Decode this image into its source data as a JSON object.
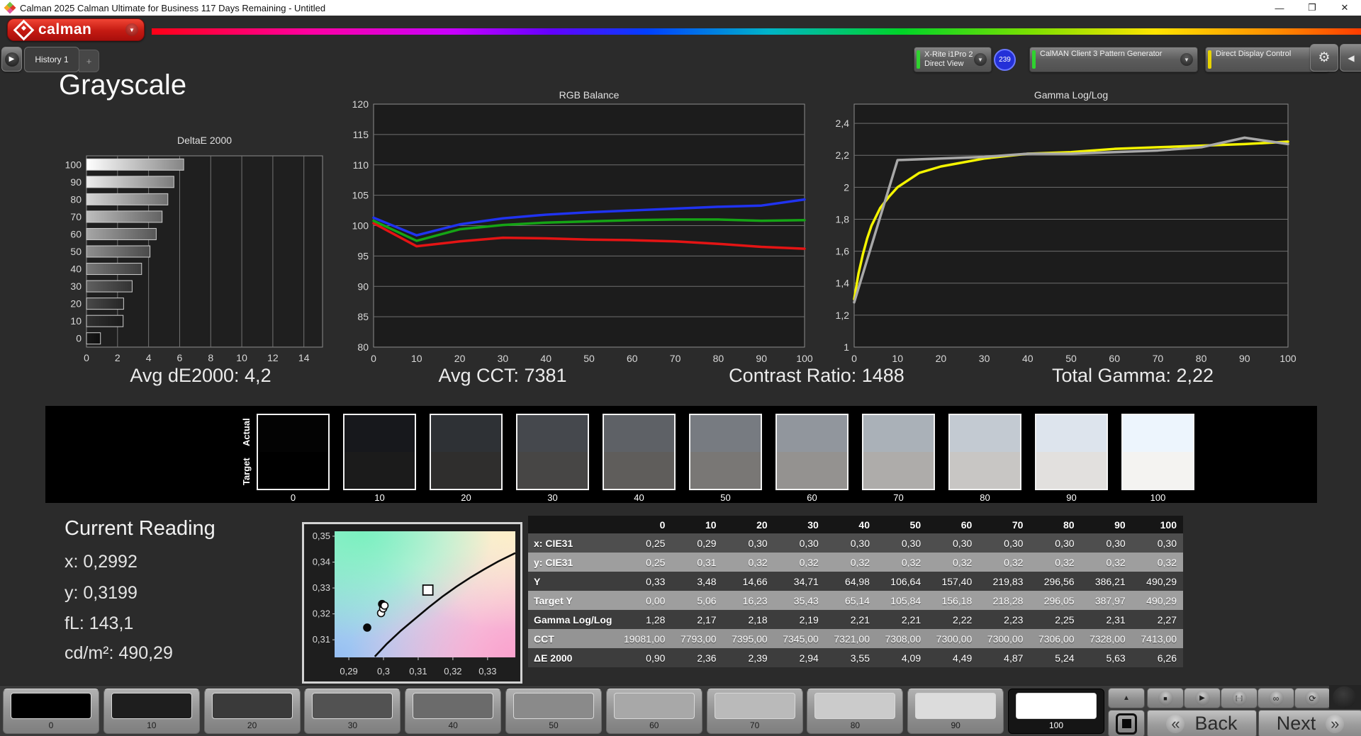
{
  "window": {
    "title": "Calman 2025 Calman Ultimate for Business 117 Days Remaining  - Untitled"
  },
  "icons": {
    "dropdown_arrow": "▼",
    "play_tab": "▶",
    "plus": "+",
    "gear": "⚙",
    "collapse_left": "◀",
    "minimize": "—",
    "restore": "❐",
    "close": "✕",
    "up_arrow": "▲",
    "stop": "■",
    "play": "▶",
    "pattern_window": "[··]",
    "continuous": "∞",
    "refresh": "⟳",
    "back_chevron": "«",
    "next_chevron": "»"
  },
  "header": {
    "logo_text": "calman",
    "history_tab": "History 1",
    "add_tab": "+",
    "meter_dropdown": {
      "line1": "X-Rite i1Pro 2",
      "line2": "Direct View",
      "stripe_color": "#2fd32f"
    },
    "meter_badge": "239",
    "pattern_dropdown": {
      "label": "CalMAN Client 3 Pattern Generator",
      "stripe_color": "#2fd32f"
    },
    "display_dropdown": {
      "label": "Direct Display Control",
      "stripe_color": "#e8d400"
    }
  },
  "page": {
    "title": "Grayscale"
  },
  "stats": {
    "avg_de": "Avg dE2000: 4,2",
    "avg_cct": "Avg CCT: 7381",
    "contrast": "Contrast Ratio: 1488",
    "total_gamma": "Total Gamma: 2,22"
  },
  "chart_data": [
    {
      "id": "deltae",
      "type": "bar",
      "title": "DeltaE 2000",
      "categories": [
        "0",
        "10",
        "20",
        "30",
        "40",
        "50",
        "60",
        "70",
        "80",
        "90",
        "100"
      ],
      "values": [
        0.9,
        2.36,
        2.39,
        2.94,
        3.55,
        4.09,
        4.49,
        4.87,
        5.24,
        5.63,
        6.26
      ],
      "xlim": [
        0,
        15.2
      ],
      "xticks": [
        0,
        2,
        4,
        6,
        8,
        10,
        12,
        14
      ],
      "note": "horizontal bars, level 100 on top, bar brightness matches gray level"
    },
    {
      "id": "rgb_balance",
      "type": "line",
      "title": "RGB Balance",
      "x": [
        0,
        10,
        20,
        30,
        40,
        50,
        60,
        70,
        80,
        90,
        100
      ],
      "ylim": [
        80,
        120
      ],
      "yticks": [
        80,
        85,
        90,
        95,
        100,
        105,
        110,
        115,
        120
      ],
      "series": [
        {
          "name": "Red",
          "color": "#e41414",
          "values": [
            100.4,
            96.6,
            97.4,
            98.0,
            97.9,
            97.7,
            97.6,
            97.4,
            97.0,
            96.5,
            96.2
          ]
        },
        {
          "name": "Green",
          "color": "#15a415",
          "values": [
            100.8,
            97.5,
            99.4,
            100.1,
            100.5,
            100.7,
            100.9,
            101.0,
            101.0,
            100.8,
            100.9
          ]
        },
        {
          "name": "Blue",
          "color": "#2033f0",
          "values": [
            101.3,
            98.4,
            100.2,
            101.2,
            101.8,
            102.2,
            102.5,
            102.8,
            103.1,
            103.3,
            104.3
          ]
        }
      ]
    },
    {
      "id": "gamma",
      "type": "line",
      "title": "Gamma Log/Log",
      "x": [
        0,
        10,
        20,
        30,
        40,
        50,
        60,
        70,
        80,
        90,
        100
      ],
      "ylim": [
        1,
        2.52
      ],
      "yticks": [
        1,
        1.2,
        1.4,
        1.6,
        1.8,
        2,
        2.2,
        2.4
      ],
      "ytick_labels": [
        "1",
        "1,2",
        "1,4",
        "1,6",
        "1,8",
        "2",
        "2,2",
        "2,4"
      ],
      "series": [
        {
          "name": "Target Gamma",
          "color": "#f4f400",
          "x": [
            0,
            1,
            2,
            3,
            4,
            6,
            8,
            10,
            15,
            20,
            30,
            40,
            50,
            60,
            70,
            80,
            90,
            100
          ],
          "values": [
            1.3,
            1.46,
            1.58,
            1.68,
            1.76,
            1.87,
            1.94,
            2.0,
            2.09,
            2.13,
            2.18,
            2.21,
            2.22,
            2.24,
            2.25,
            2.26,
            2.27,
            2.285
          ]
        },
        {
          "name": "Measured Gamma",
          "color": "#a8a8a8",
          "x": [
            0,
            10,
            20,
            30,
            40,
            50,
            60,
            70,
            80,
            90,
            100
          ],
          "values": [
            1.28,
            2.17,
            2.18,
            2.19,
            2.21,
            2.21,
            2.22,
            2.23,
            2.25,
            2.31,
            2.27
          ]
        }
      ]
    },
    {
      "id": "cie_chart",
      "type": "scatter",
      "title": "",
      "xlim": [
        0.2859,
        0.338
      ],
      "ylim": [
        0.3032,
        0.3519
      ],
      "xtick_values": [
        0.29,
        0.3,
        0.31,
        0.32,
        0.33
      ],
      "xtick_labels": [
        "0,29",
        "0,3",
        "0,31",
        "0,32",
        "0,33"
      ],
      "ytick_values": [
        0.35,
        0.34,
        0.33,
        0.32,
        0.31
      ],
      "ytick_labels": [
        "0,35",
        "0,34",
        "0,33",
        "0,32",
        "0,31"
      ],
      "locus": [
        [
          0.2975,
          0.3035
        ],
        [
          0.301,
          0.3085
        ],
        [
          0.305,
          0.3135
        ],
        [
          0.309,
          0.318
        ],
        [
          0.313,
          0.3225
        ],
        [
          0.317,
          0.3267
        ],
        [
          0.321,
          0.3305
        ],
        [
          0.325,
          0.334
        ],
        [
          0.329,
          0.3372
        ],
        [
          0.333,
          0.3402
        ],
        [
          0.338,
          0.3435
        ]
      ],
      "points": [
        {
          "x": 0.2953,
          "y": 0.3147,
          "fill": "black"
        },
        {
          "x": 0.2993,
          "y": 0.3203,
          "fill": "white"
        },
        {
          "x": 0.2999,
          "y": 0.3221,
          "fill": "white"
        },
        {
          "x": 0.2996,
          "y": 0.3238,
          "fill": "black"
        },
        {
          "x": 0.3003,
          "y": 0.3232,
          "fill": "white"
        }
      ],
      "target_point": {
        "x": 0.3128,
        "y": 0.3292
      }
    }
  ],
  "swatch_strip": {
    "row_labels": [
      "Actual",
      "Target"
    ],
    "levels": [
      "0",
      "10",
      "20",
      "30",
      "40",
      "50",
      "60",
      "70",
      "80",
      "90",
      "100"
    ],
    "actual_colors": [
      "#030303",
      "#17181c",
      "#2e3135",
      "#45484d",
      "#5e6166",
      "#777b81",
      "#91969d",
      "#aab1b8",
      "#c3cad2",
      "#dde4ed",
      "#edf5fd"
    ],
    "target_colors": [
      "#000000",
      "#1b1b1b",
      "#2f2e2d",
      "#474645",
      "#5f5d5b",
      "#797775",
      "#949290",
      "#aeacaa",
      "#c8c6c4",
      "#e2e0de",
      "#f4f3f1"
    ]
  },
  "current_reading": {
    "title": "Current Reading",
    "lines": [
      "x: 0,2992",
      "y: 0,3199",
      "fL: 143,1",
      "cd/m²: 490,29"
    ]
  },
  "table": {
    "columns": [
      "0",
      "10",
      "20",
      "30",
      "40",
      "50",
      "60",
      "70",
      "80",
      "90",
      "100"
    ],
    "rows": [
      {
        "label": "x: CIE31",
        "values": [
          "0,25",
          "0,29",
          "0,30",
          "0,30",
          "0,30",
          "0,30",
          "0,30",
          "0,30",
          "0,30",
          "0,30",
          "0,30"
        ]
      },
      {
        "label": "y: CIE31",
        "values": [
          "0,25",
          "0,31",
          "0,32",
          "0,32",
          "0,32",
          "0,32",
          "0,32",
          "0,32",
          "0,32",
          "0,32",
          "0,32"
        ]
      },
      {
        "label": "Y",
        "values": [
          "0,33",
          "3,48",
          "14,66",
          "34,71",
          "64,98",
          "106,64",
          "157,40",
          "219,83",
          "296,56",
          "386,21",
          "490,29"
        ]
      },
      {
        "label": "Target Y",
        "values": [
          "0,00",
          "5,06",
          "16,23",
          "35,43",
          "65,14",
          "105,84",
          "156,18",
          "218,28",
          "296,05",
          "387,97",
          "490,29"
        ]
      },
      {
        "label": "Gamma Log/Log",
        "values": [
          "1,28",
          "2,17",
          "2,18",
          "2,19",
          "2,21",
          "2,21",
          "2,22",
          "2,23",
          "2,25",
          "2,31",
          "2,27"
        ]
      },
      {
        "label": "CCT",
        "values": [
          "19081,00",
          "7793,00",
          "7395,00",
          "7345,00",
          "7321,00",
          "7308,00",
          "7300,00",
          "7300,00",
          "7306,00",
          "7328,00",
          "7413,00"
        ]
      },
      {
        "label": "ΔE 2000",
        "values": [
          "0,90",
          "2,36",
          "2,39",
          "2,94",
          "3,55",
          "4,09",
          "4,49",
          "4,87",
          "5,24",
          "5,63",
          "6,26"
        ]
      }
    ],
    "row_colors": [
      "#4e4e4e",
      "#9e9e9e",
      "#3d3d3d",
      "#9e9e9e",
      "#3d3d3d",
      "#949494",
      "#3d3d3d"
    ]
  },
  "bottom_bar": {
    "patches": [
      {
        "label": "0",
        "color": "#000000"
      },
      {
        "label": "10",
        "color": "#1e1e1e"
      },
      {
        "label": "20",
        "color": "#3a3a3a"
      },
      {
        "label": "30",
        "color": "#525252"
      },
      {
        "label": "40",
        "color": "#6b6b6b"
      },
      {
        "label": "50",
        "color": "#8a8a8a"
      },
      {
        "label": "60",
        "color": "#a8a8a8"
      },
      {
        "label": "70",
        "color": "#bababa"
      },
      {
        "label": "80",
        "color": "#cbcbcb"
      },
      {
        "label": "90",
        "color": "#dcdcdc"
      },
      {
        "label": "100",
        "color": "#ffffff"
      }
    ],
    "selected_patch": "100",
    "back_label": "Back",
    "next_label": "Next"
  }
}
